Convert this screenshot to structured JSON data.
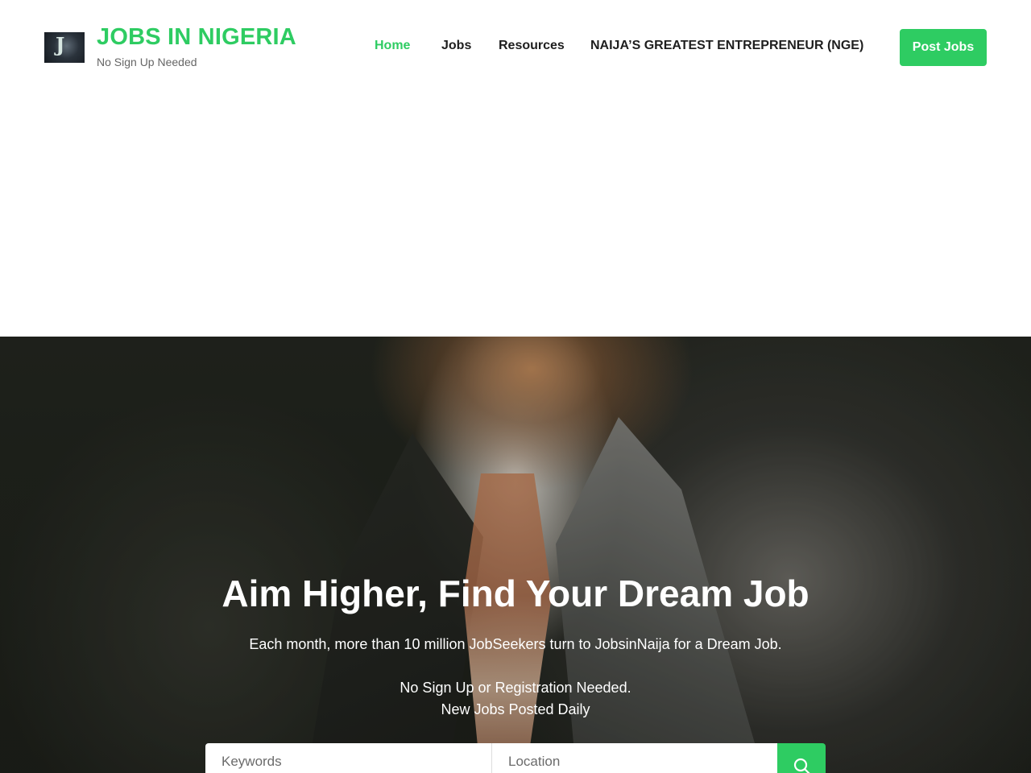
{
  "header": {
    "brand_title": "JOBS IN NIGERIA",
    "brand_tagline": "No Sign Up Needed",
    "logo_icon": "logo-image",
    "nav": [
      {
        "label": "Home",
        "active": true
      },
      {
        "label": "Jobs",
        "active": false
      },
      {
        "label": "Resources",
        "active": false
      },
      {
        "label": "NAIJA’S GREATEST ENTREPRENEUR (NGE)",
        "active": false
      }
    ],
    "post_button": "Post Jobs"
  },
  "hero": {
    "title": "Aim Higher, Find Your Dream Job",
    "subtitle": "Each month, more than 10 million JobSeekers turn to JobsinNaija for a Dream Job.",
    "line1": "No Sign Up or Registration Needed.",
    "line2": "New Jobs Posted Daily",
    "background_image": "man-in-suit-with-tie"
  },
  "search": {
    "keywords_placeholder": "Keywords",
    "location_placeholder": "Location",
    "button_icon": "search-icon"
  },
  "colors": {
    "accent": "#2ecc62",
    "nav_text": "#1e1e1e",
    "tagline": "#666666"
  }
}
